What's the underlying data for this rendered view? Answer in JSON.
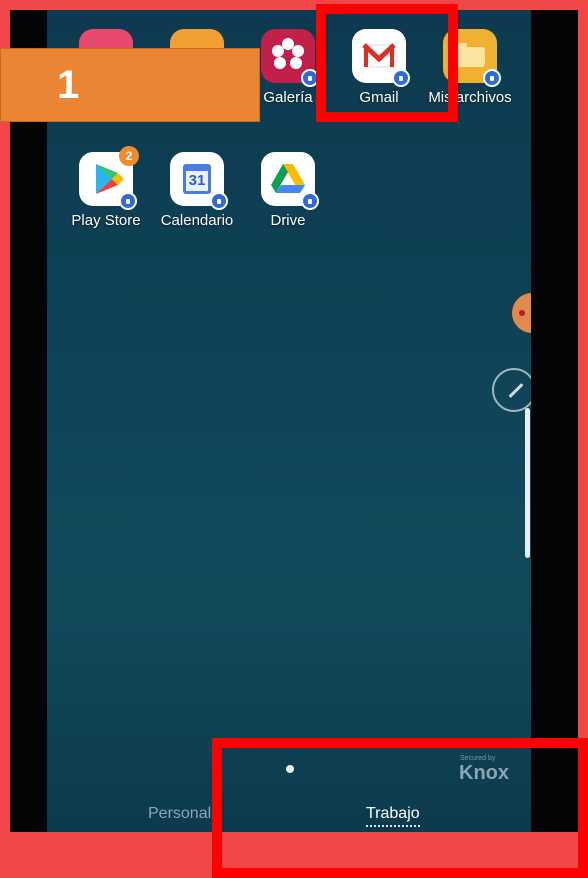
{
  "step_label": "1",
  "apps_row1": [
    {
      "label": "",
      "icon": "messages-icon",
      "color": "#e84a6e"
    },
    {
      "label": "",
      "icon": "contacts-icon",
      "color": "#f0a035"
    },
    {
      "label": "Galería",
      "icon": "gallery-icon",
      "color": "#c21f4a"
    },
    {
      "label": "Gmail",
      "icon": "gmail-icon",
      "color": "#ffffff"
    },
    {
      "label": "Mis archivos",
      "icon": "folder-icon",
      "color": "#f0b030"
    }
  ],
  "apps_row2": [
    {
      "label": "Play Store",
      "icon": "play-store-icon",
      "badge": "2"
    },
    {
      "label": "Calendario",
      "icon": "calendar-icon",
      "day": "31"
    },
    {
      "label": "Drive",
      "icon": "drive-icon"
    }
  ],
  "knox": {
    "secured_by": "Secured by",
    "brand": "Knox"
  },
  "tabs": {
    "personal": "Personal",
    "work": "Trabajo"
  },
  "colors": {
    "highlight": "#ff0000",
    "callout": "#ec8533",
    "background": "#f04848"
  }
}
